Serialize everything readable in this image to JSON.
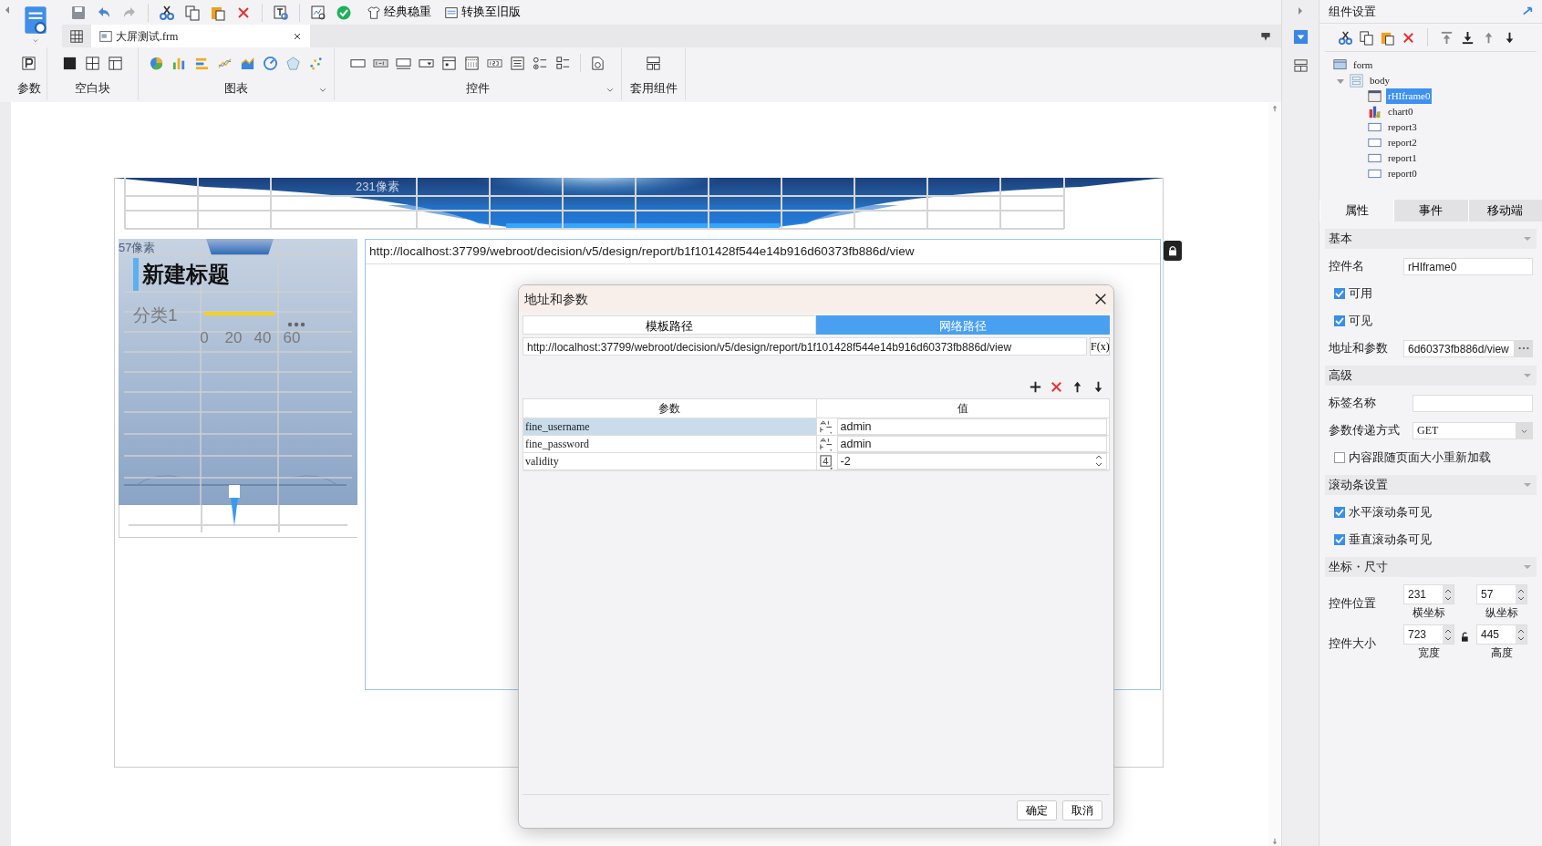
{
  "toolbar": {
    "buttons": [
      {
        "kind": "theme",
        "label": "经典稳重"
      },
      {
        "kind": "convert",
        "label": "转换至旧版"
      }
    ]
  },
  "file_tab": {
    "title": "大屏测试.frm"
  },
  "ribbon_groups": [
    {
      "kind": "params",
      "label": "参数",
      "has_menu": false
    },
    {
      "kind": "blocks",
      "label": "空白块",
      "has_menu": false
    },
    {
      "kind": "charts",
      "label": "图表",
      "has_menu": true
    },
    {
      "kind": "controls",
      "label": "控件",
      "has_menu": true
    },
    {
      "kind": "templates",
      "label": "套用组件",
      "has_menu": false
    }
  ],
  "canvas": {
    "x_marker": "231像素",
    "y_marker": "57像素",
    "title": "新建标题",
    "chart_data": {
      "type": "bar",
      "orientation": "horizontal",
      "categories": [
        "分类1"
      ],
      "values": [
        48
      ],
      "xlim": [
        0,
        60
      ],
      "xticks": [
        0,
        20,
        40,
        60
      ]
    },
    "iframe_url": "http://localhost:37799/webroot/decision/v5/design/report/b1f101428f544e14b916d60373fb886d/view"
  },
  "dialog": {
    "title": "地址和参数",
    "tabs": [
      {
        "label": "模板路径",
        "selected": false
      },
      {
        "label": "网络路径",
        "selected": true
      }
    ],
    "url": "http://localhost:37799/webroot/decision/v5/design/report/b1f101428f544e14b916d60373fb886d/view",
    "formula_button": "F(x)",
    "columns": [
      "参数",
      "值"
    ],
    "rows": [
      {
        "name": "fine_username",
        "kind": "text",
        "value": "admin",
        "selected": true
      },
      {
        "name": "fine_password",
        "kind": "text",
        "value": "admin",
        "selected": false
      },
      {
        "name": "validity",
        "kind": "number",
        "value": "-2",
        "selected": false
      }
    ],
    "buttons": [
      "确定",
      "取消"
    ]
  },
  "panel": {
    "title": "组件设置",
    "tree": [
      {
        "label": "form",
        "kind": "form",
        "children": [
          {
            "label": "body",
            "kind": "layout",
            "expanded": true,
            "children": [
              {
                "label": "rHIframe0",
                "kind": "iframe",
                "selected": true
              },
              {
                "label": "chart0",
                "kind": "chart",
                "selected": false
              },
              {
                "label": "report3",
                "kind": "report",
                "selected": false
              },
              {
                "label": "report2",
                "kind": "report",
                "selected": false
              },
              {
                "label": "report1",
                "kind": "report",
                "selected": false
              },
              {
                "label": "report0",
                "kind": "report",
                "selected": false
              }
            ]
          }
        ]
      }
    ],
    "tabs": [
      {
        "label": "属性",
        "selected": true
      },
      {
        "label": "事件",
        "selected": false
      },
      {
        "label": "移动端",
        "selected": false
      }
    ],
    "sections": [
      {
        "title": "基本",
        "expanded": true,
        "rows": [
          {
            "kind": "text",
            "label": "控件名",
            "value": "rHIframe0"
          },
          {
            "kind": "checkbox",
            "label": "可用",
            "checked": true
          },
          {
            "kind": "checkbox",
            "label": "可见",
            "checked": true
          },
          {
            "kind": "browse",
            "label": "地址和参数",
            "value": "6d60373fb886d/view"
          }
        ]
      },
      {
        "title": "高级",
        "expanded": true,
        "rows": [
          {
            "kind": "text",
            "label": "标签名称"
          },
          {
            "kind": "select",
            "label": "参数传递方式",
            "value": "GET"
          },
          {
            "kind": "checkbox",
            "label": "内容跟随页面大小重新加载",
            "checked": false
          }
        ]
      },
      {
        "title": "滚动条设置",
        "expanded": true,
        "rows": [
          {
            "kind": "checkbox",
            "label": "水平滚动条可见",
            "checked": true
          },
          {
            "kind": "checkbox",
            "label": "垂直滚动条可见",
            "checked": true
          }
        ]
      },
      {
        "title": "坐标・尺寸",
        "expanded": true,
        "rows": [
          {
            "kind": "pair",
            "label": "控件位置",
            "fields": [
              {
                "value": "231",
                "caption": "横坐标"
              },
              {
                "value": "57",
                "caption": "纵坐标"
              }
            ]
          },
          {
            "kind": "pair",
            "label": "控件大小",
            "locked": false,
            "fields": [
              {
                "value": "723",
                "caption": "宽度"
              },
              {
                "value": "445",
                "caption": "高度"
              }
            ]
          }
        ]
      }
    ]
  }
}
